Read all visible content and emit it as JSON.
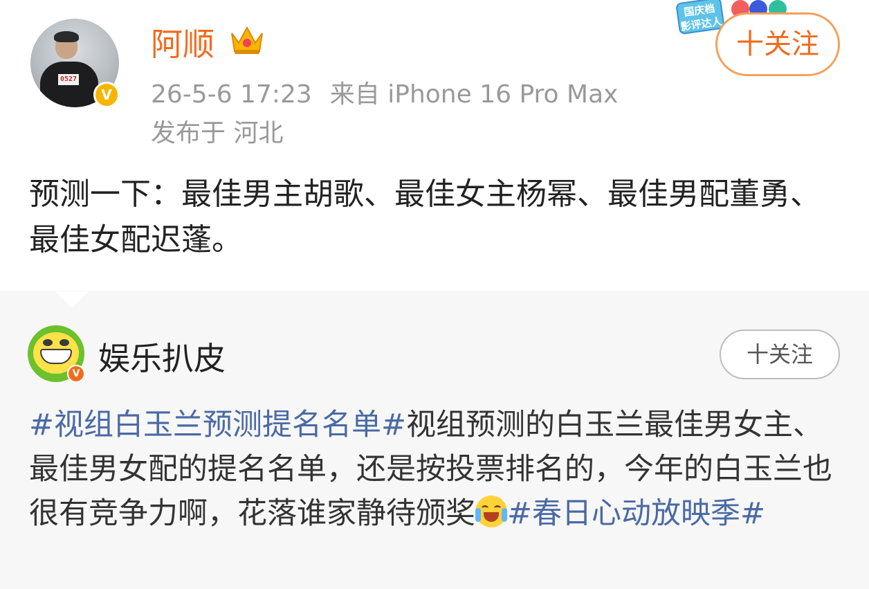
{
  "post": {
    "username": "阿顺",
    "timestamp": "26-5-6 17:23",
    "source": "来自 iPhone 16 Pro Max",
    "location": "发布于 河北",
    "follow_label": "十关注",
    "badge_text": "国庆档\n影评达人",
    "avatar_bib": "0527",
    "text": "预测一下：最佳男主胡歌、最佳女主杨幂、最佳男配董勇、最佳女配迟蓬。"
  },
  "repost": {
    "username": "娱乐扒皮",
    "follow_label": "十关注",
    "topic1": "#视组白玉兰预测提名名单#",
    "text1": "视组预测的白玉兰最佳男女主、最佳男女配的提名名单，还是按投票排名的，今年的白玉兰也很有竞争力啊，花落谁家静待颁奖",
    "topic2": "#春日心动放映季#"
  },
  "colors": {
    "username": "#f26b1d",
    "meta": "#999999",
    "topic_link": "#4a6aa5",
    "follow_border": "#f6a05a",
    "repost_bg": "#f7f7f7"
  },
  "icons": {
    "crown": "crown-icon",
    "verified": "verified-v-icon",
    "emoji": "laugh-cry-emoji-icon"
  }
}
